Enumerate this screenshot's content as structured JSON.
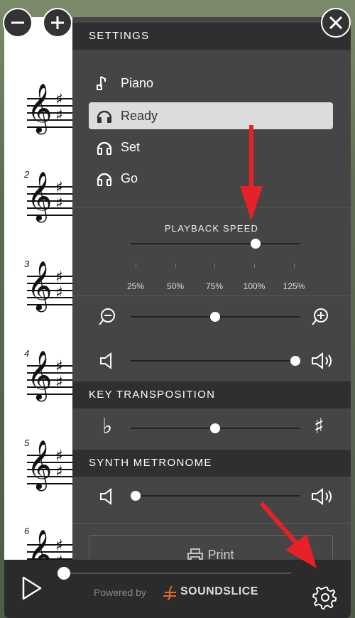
{
  "panel": {
    "settings_header": "SETTINGS",
    "instruments": [
      {
        "label": "Piano",
        "icon": "music-note-icon",
        "selected": false
      },
      {
        "label": "Ready",
        "icon": "headphones-icon",
        "selected": true
      },
      {
        "label": "Set",
        "icon": "headphones-icon",
        "selected": false
      },
      {
        "label": "Go",
        "icon": "headphones-icon",
        "selected": false
      }
    ],
    "playback_speed": {
      "label": "PLAYBACK SPEED",
      "ticks": [
        "25%",
        "50%",
        "75%",
        "100%",
        "125%"
      ],
      "value": "100%"
    },
    "zoom_slider": {
      "value": 0.5
    },
    "volume_slider": {
      "value": 1.0
    },
    "key_transposition": {
      "header": "KEY TRANSPOSITION",
      "value": 0.5
    },
    "synth_metronome": {
      "header": "SYNTH METRONOME",
      "value": 0.03
    },
    "print_label": "Print"
  },
  "score": {
    "measures": [
      "",
      "2",
      "3",
      "4",
      "5",
      "6"
    ]
  },
  "bottombar": {
    "powered_by": "Powered by",
    "brand": "SOUNDSLICE",
    "progress": 0.0
  },
  "colors": {
    "panel_bg": "#454545",
    "header_bg": "#2f2f2f",
    "selected_bg": "#dcdcdc",
    "annotation_arrow": "#e8202a"
  }
}
